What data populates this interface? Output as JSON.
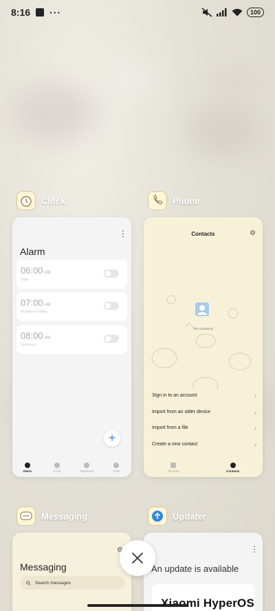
{
  "statusbar": {
    "time": "8:16",
    "battery": "100"
  },
  "apps": {
    "clock": {
      "name": "Clock",
      "title": "Alarm",
      "alarms": [
        {
          "time": "06:00",
          "ampm": "AM",
          "sub": "Daily"
        },
        {
          "time": "07:00",
          "ampm": "AM",
          "sub": "Monday to Friday"
        },
        {
          "time": "08:00",
          "ampm": "AM",
          "sub": "Just once"
        }
      ],
      "add": "+",
      "tabs": [
        "Alarm",
        "Clock",
        "Stopwatch",
        "Timer"
      ]
    },
    "phone": {
      "name": "Phone",
      "title": "Contacts",
      "empty": "No contacts",
      "menu": [
        "Sign in to an account",
        "Import from an older device",
        "Import from a file",
        "Create a new contact"
      ],
      "tabs": [
        "Recents",
        "Contacts"
      ]
    },
    "messaging": {
      "name": "Messaging",
      "title": "Messaging",
      "search_placeholder": "Search messages"
    },
    "updater": {
      "name": "Updater",
      "title": "An update is available"
    }
  },
  "brand": "Xiaomi HyperOS",
  "icons": {
    "chevron": "›",
    "gear": "⚙",
    "kebab": "⋮"
  },
  "colors": {
    "accent": "#3a8be8",
    "updater_icon": "#2f86e0"
  }
}
